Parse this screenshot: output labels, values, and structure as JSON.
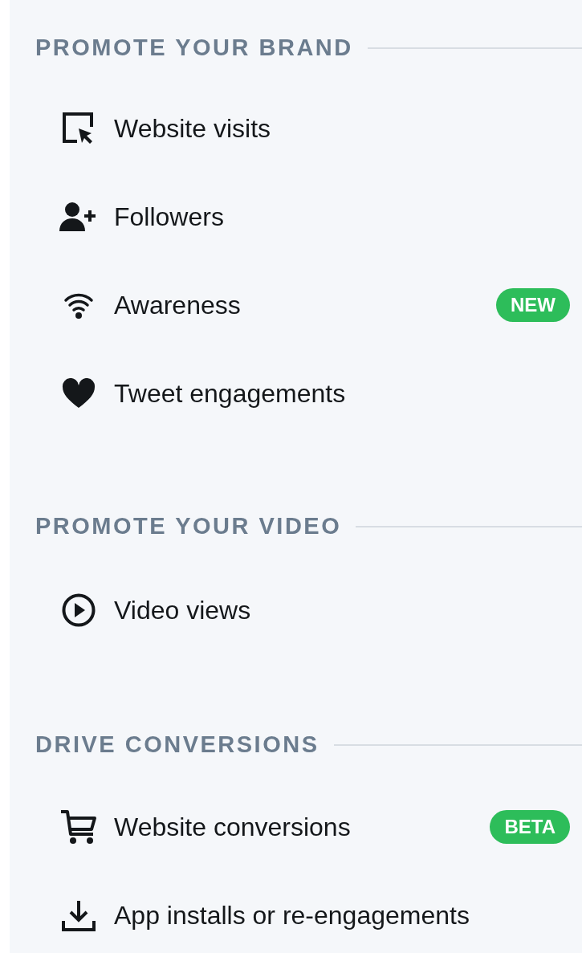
{
  "sections": [
    {
      "title": "PROMOTE YOUR BRAND",
      "items": [
        {
          "label": "Website visits"
        },
        {
          "label": "Followers"
        },
        {
          "label": "Awareness",
          "badge": "NEW"
        },
        {
          "label": "Tweet engagements"
        }
      ]
    },
    {
      "title": "PROMOTE YOUR VIDEO",
      "items": [
        {
          "label": "Video views"
        }
      ]
    },
    {
      "title": "DRIVE CONVERSIONS",
      "items": [
        {
          "label": "Website conversions",
          "badge": "BETA"
        },
        {
          "label": "App installs or re-engagements"
        }
      ]
    }
  ]
}
